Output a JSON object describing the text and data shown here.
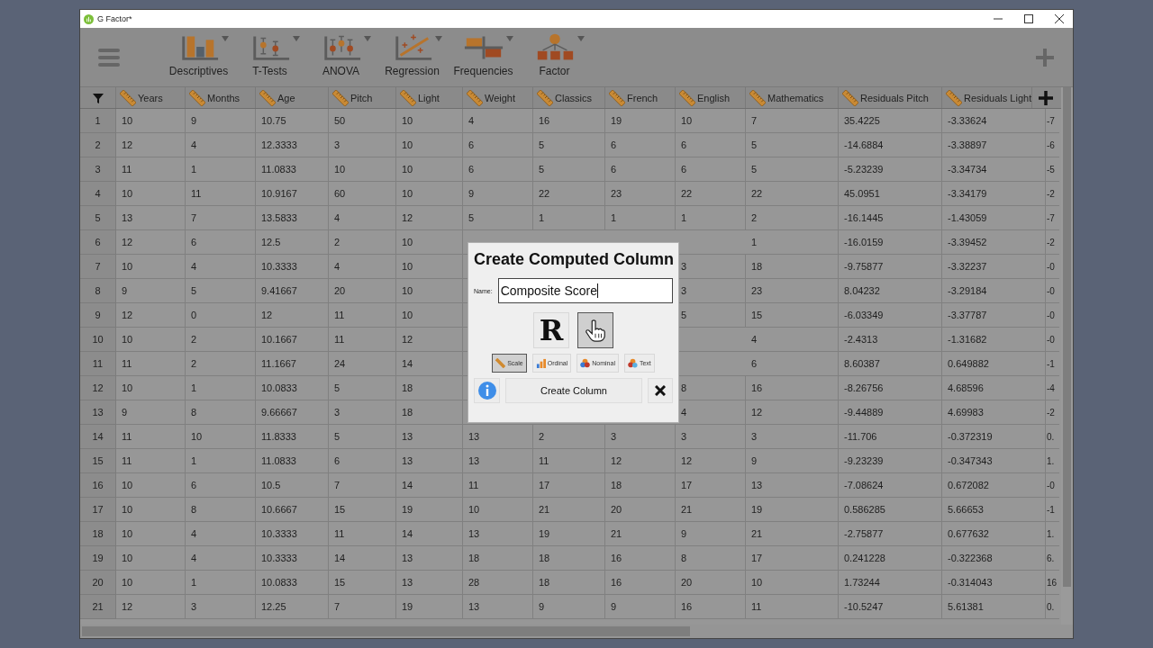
{
  "window": {
    "title": "G Factor*"
  },
  "toolbar": {
    "items": [
      {
        "kind": "descriptives",
        "label": "Descriptives"
      },
      {
        "kind": "ttests",
        "label": "T-Tests"
      },
      {
        "kind": "anova",
        "label": "ANOVA"
      },
      {
        "kind": "regression",
        "label": "Regression"
      },
      {
        "kind": "frequencies",
        "label": "Frequencies"
      },
      {
        "kind": "factor",
        "label": "Factor"
      }
    ]
  },
  "table": {
    "columns": [
      {
        "name": "Years",
        "kind": "scale"
      },
      {
        "name": "Months",
        "kind": "scale"
      },
      {
        "name": "Age",
        "kind": "scale"
      },
      {
        "name": "Pitch",
        "kind": "scale"
      },
      {
        "name": "Light",
        "kind": "scale"
      },
      {
        "name": "Weight",
        "kind": "scale"
      },
      {
        "name": "Classics",
        "kind": "scale"
      },
      {
        "name": "French",
        "kind": "scale"
      },
      {
        "name": "English",
        "kind": "scale"
      },
      {
        "name": "Mathematics",
        "kind": "scale"
      },
      {
        "name": "Residuals Pitch",
        "kind": "scale"
      },
      {
        "name": "Residuals Light",
        "kind": "scale"
      }
    ],
    "rows": [
      {
        "number": "1",
        "cells": [
          "10",
          "9",
          "10.75",
          "50",
          "10",
          "4",
          "16",
          "19",
          "10",
          "7",
          "35.4225",
          "-3.33624",
          "-7"
        ]
      },
      {
        "number": "2",
        "cells": [
          "12",
          "4",
          "12.3333",
          "3",
          "10",
          "6",
          "5",
          "6",
          "6",
          "5",
          "-14.6884",
          "-3.38897",
          "-6"
        ]
      },
      {
        "number": "3",
        "cells": [
          "11",
          "1",
          "11.0833",
          "10",
          "10",
          "6",
          "5",
          "6",
          "6",
          "5",
          "-5.23239",
          "-3.34734",
          "-5"
        ]
      },
      {
        "number": "4",
        "cells": [
          "10",
          "11",
          "10.9167",
          "60",
          "10",
          "9",
          "22",
          "23",
          "22",
          "22",
          "45.0951",
          "-3.34179",
          "-2"
        ]
      },
      {
        "number": "5",
        "cells": [
          "13",
          "7",
          "13.5833",
          "4",
          "12",
          "5",
          "1",
          "1",
          "1",
          "2",
          "-16.1445",
          "-1.43059",
          "-7"
        ]
      },
      {
        "number": "6",
        "cells": [
          "12",
          "6",
          "12.5",
          "2",
          "10",
          null,
          null,
          null,
          null,
          "1",
          "-16.0159",
          "-3.39452",
          "-2"
        ]
      },
      {
        "number": "7",
        "cells": [
          "10",
          "4",
          "10.3333",
          "4",
          "10",
          null,
          null,
          null,
          "3",
          "18",
          "-9.75877",
          "-3.32237",
          "-0"
        ]
      },
      {
        "number": "8",
        "cells": [
          "9",
          "5",
          "9.41667",
          "20",
          "10",
          null,
          null,
          null,
          "3",
          "23",
          "8.04232",
          "-3.29184",
          "-0"
        ]
      },
      {
        "number": "9",
        "cells": [
          "12",
          "0",
          "12",
          "11",
          "10",
          null,
          null,
          null,
          "5",
          "15",
          "-6.03349",
          "-3.37787",
          "-0"
        ]
      },
      {
        "number": "10",
        "cells": [
          "10",
          "2",
          "10.1667",
          "11",
          "12",
          null,
          null,
          null,
          null,
          "4",
          "-2.4313",
          "-1.31682",
          "-0"
        ]
      },
      {
        "number": "11",
        "cells": [
          "11",
          "2",
          "11.1667",
          "24",
          "14",
          null,
          null,
          null,
          null,
          "6",
          "8.60387",
          "0.649882",
          "-1"
        ]
      },
      {
        "number": "12",
        "cells": [
          "10",
          "1",
          "10.0833",
          "5",
          "18",
          null,
          null,
          null,
          "8",
          "16",
          "-8.26756",
          "4.68596",
          "-4"
        ]
      },
      {
        "number": "13",
        "cells": [
          "9",
          "8",
          "9.66667",
          "3",
          "18",
          null,
          null,
          null,
          "4",
          "12",
          "-9.44889",
          "4.69983",
          "-2"
        ]
      },
      {
        "number": "14",
        "cells": [
          "11",
          "10",
          "11.8333",
          "5",
          "13",
          "13",
          "2",
          "3",
          "3",
          "3",
          "-11.706",
          "-0.372319",
          "0."
        ]
      },
      {
        "number": "15",
        "cells": [
          "11",
          "1",
          "11.0833",
          "6",
          "13",
          "13",
          "11",
          "12",
          "12",
          "9",
          "-9.23239",
          "-0.347343",
          "1."
        ]
      },
      {
        "number": "16",
        "cells": [
          "10",
          "6",
          "10.5",
          "7",
          "14",
          "11",
          "17",
          "18",
          "17",
          "13",
          "-7.08624",
          "0.672082",
          "-0"
        ]
      },
      {
        "number": "17",
        "cells": [
          "10",
          "8",
          "10.6667",
          "15",
          "19",
          "10",
          "21",
          "20",
          "21",
          "19",
          "0.586285",
          "5.66653",
          "-1"
        ]
      },
      {
        "number": "18",
        "cells": [
          "10",
          "4",
          "10.3333",
          "11",
          "14",
          "13",
          "19",
          "21",
          "9",
          "21",
          "-2.75877",
          "0.677632",
          "1."
        ]
      },
      {
        "number": "19",
        "cells": [
          "10",
          "4",
          "10.3333",
          "14",
          "13",
          "18",
          "18",
          "16",
          "8",
          "17",
          "0.241228",
          "-0.322368",
          "6."
        ]
      },
      {
        "number": "20",
        "cells": [
          "10",
          "1",
          "10.0833",
          "15",
          "13",
          "28",
          "18",
          "16",
          "20",
          "10",
          "1.73244",
          "-0.314043",
          "16"
        ]
      },
      {
        "number": "21",
        "cells": [
          "12",
          "3",
          "12.25",
          "7",
          "19",
          "13",
          "9",
          "9",
          "16",
          "11",
          "-10.5247",
          "5.61381",
          "0."
        ]
      }
    ]
  },
  "dialog": {
    "title": "Create Computed Column",
    "name_label": "Name:",
    "name_value": "Composite Score",
    "modes": [
      {
        "kind": "r",
        "label": "R",
        "selected": false
      },
      {
        "kind": "hand",
        "selected": true
      }
    ],
    "types": [
      {
        "kind": "scale",
        "label": "Scale",
        "selected": true
      },
      {
        "kind": "ordinal",
        "label": "Ordinal",
        "selected": false
      },
      {
        "kind": "nominal",
        "label": "Nominal",
        "selected": false
      },
      {
        "kind": "text",
        "label": "Text",
        "selected": false
      }
    ],
    "create_button": "Create Column"
  }
}
